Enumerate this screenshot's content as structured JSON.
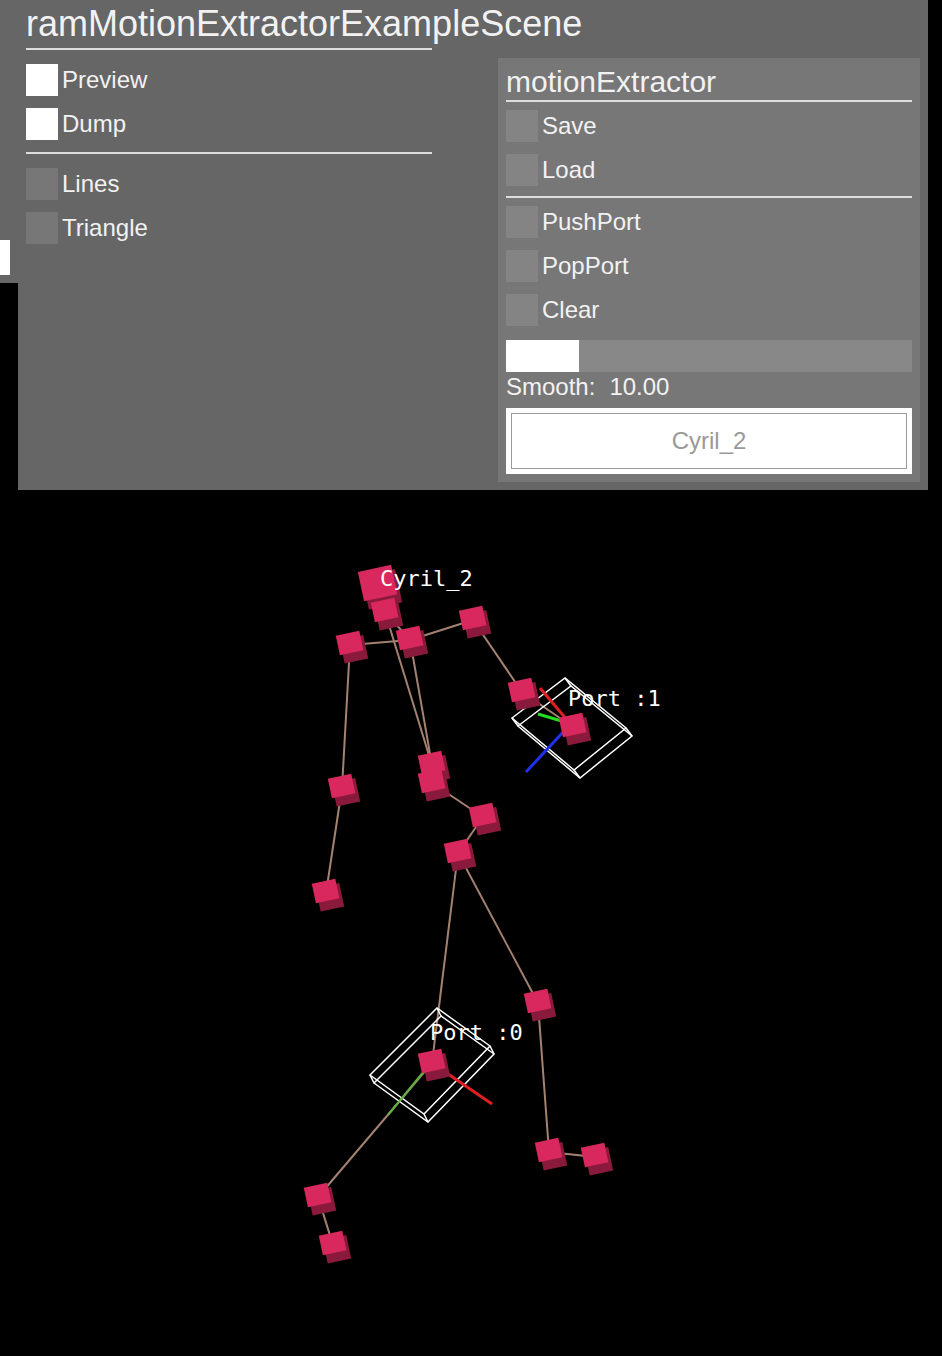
{
  "window": {
    "title": "ramMotionExtractorExampleScene"
  },
  "left_panel": {
    "groups": [
      {
        "items": [
          {
            "label": "Preview",
            "checked": true
          },
          {
            "label": "Dump",
            "checked": true
          }
        ]
      },
      {
        "items": [
          {
            "label": "Lines",
            "checked": false
          },
          {
            "label": "Triangle",
            "checked": false
          }
        ]
      }
    ]
  },
  "motion_extractor": {
    "title": "motionExtractor",
    "groups": [
      {
        "items": [
          {
            "label": "Save",
            "checked": false
          },
          {
            "label": "Load",
            "checked": false
          }
        ]
      },
      {
        "items": [
          {
            "label": "PushPort",
            "checked": false
          },
          {
            "label": "PopPort",
            "checked": false
          },
          {
            "label": "Clear",
            "checked": false
          }
        ]
      }
    ],
    "slider": {
      "label": "Smooth:",
      "reading": "10.00",
      "level": 0.18
    },
    "actor_button": {
      "label": "Cyril_2"
    }
  },
  "scene": {
    "actor_label": "Cyril_2",
    "ports": [
      {
        "label": "Port :1"
      },
      {
        "label": "Port :0"
      }
    ]
  }
}
